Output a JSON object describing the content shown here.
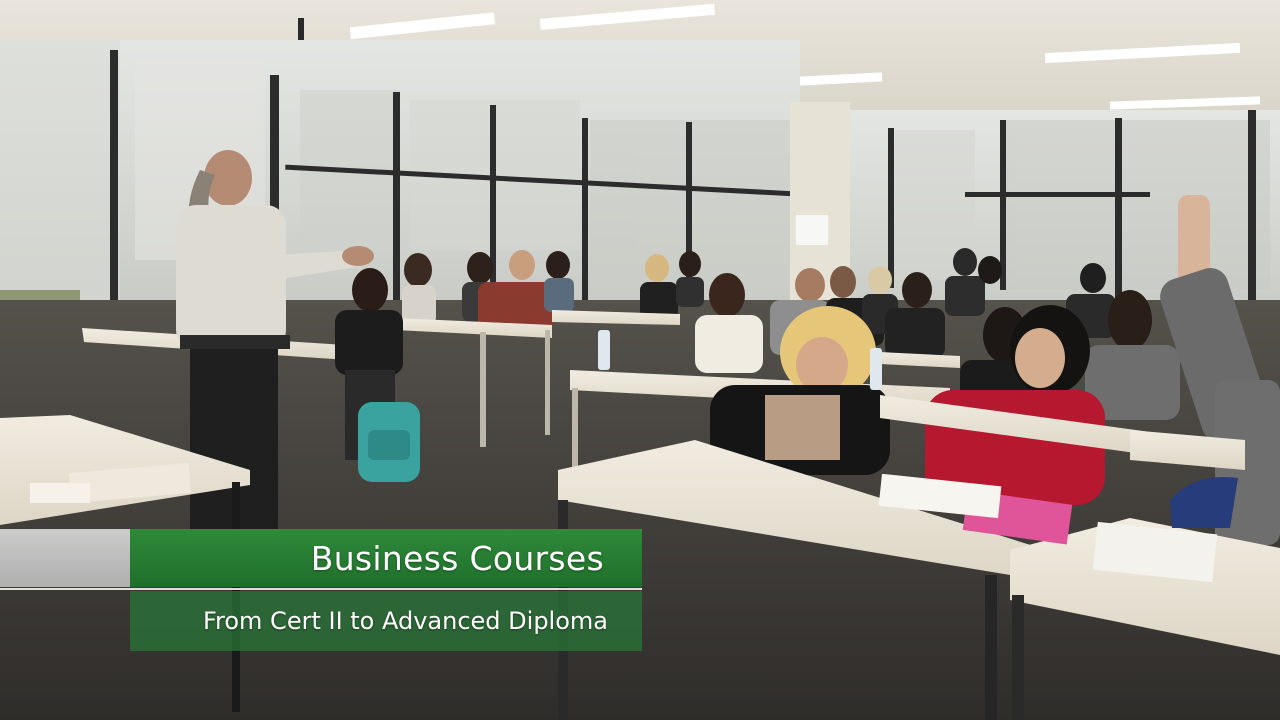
{
  "lower_third": {
    "title": "Business Courses",
    "subtitle": "From Cert II to Advanced Diploma"
  },
  "colors": {
    "banner_green": "#2a8034",
    "banner_subtitle_green": "#2f7a3c",
    "banner_white_band": "#cfcfcf"
  }
}
